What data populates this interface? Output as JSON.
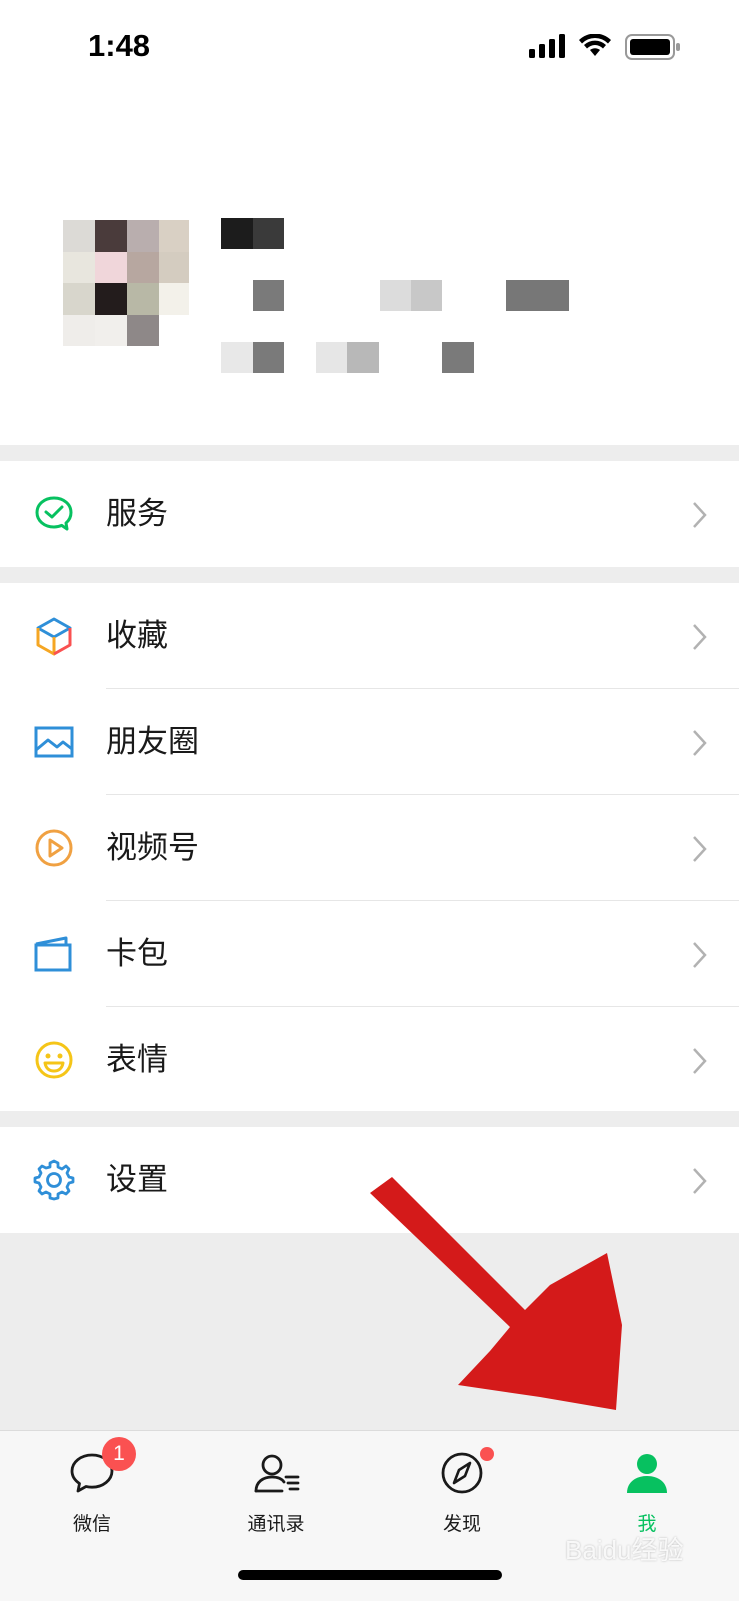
{
  "status_bar": {
    "time": "1:48"
  },
  "menu": {
    "group1": [
      {
        "label": "服务",
        "icon": "service-icon",
        "color": "#07c160"
      }
    ],
    "group2": [
      {
        "label": "收藏",
        "icon": "favorites-icon",
        "color": "#f5a623"
      },
      {
        "label": "朋友圈",
        "icon": "moments-icon",
        "color": "#2f8fd8"
      },
      {
        "label": "视频号",
        "icon": "channels-icon",
        "color": "#f0a142"
      },
      {
        "label": "卡包",
        "icon": "card-wallet-icon",
        "color": "#2f8fd8"
      },
      {
        "label": "表情",
        "icon": "sticker-icon",
        "color": "#f5c518"
      }
    ],
    "group3": [
      {
        "label": "设置",
        "icon": "settings-icon",
        "color": "#2f8fd8"
      }
    ]
  },
  "tabbar": {
    "tabs": [
      {
        "label": "微信",
        "icon": "chat-icon",
        "badge": "1"
      },
      {
        "label": "通讯录",
        "icon": "contacts-icon"
      },
      {
        "label": "发现",
        "icon": "discover-icon"
      },
      {
        "label": "我",
        "icon": "me-icon",
        "active": true
      }
    ]
  },
  "colors": {
    "accent": "#07c160",
    "badge": "#fa5151",
    "annotation_arrow": "#d41a1a"
  },
  "watermark": "Baidu经验"
}
